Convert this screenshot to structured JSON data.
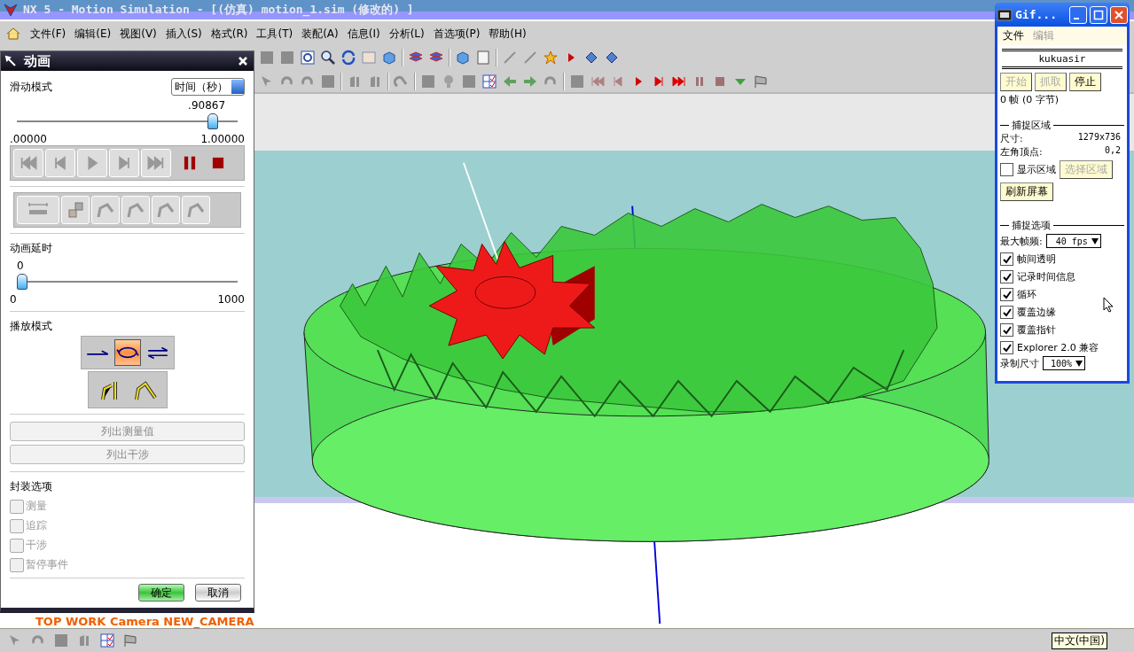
{
  "window": {
    "title": "NX 5 - Motion Simulation - [(仿真) motion_1.sim (修改的) ]"
  },
  "menu": [
    "文件(F)",
    "编辑(E)",
    "视图(V)",
    "插入(S)",
    "格式(R)",
    "工具(T)",
    "装配(A)",
    "信息(I)",
    "分析(L)",
    "首选项(P)",
    "帮助(H)"
  ],
  "animation_dialog": {
    "title": "动画",
    "slide_mode": {
      "label": "滑动模式",
      "value": "时间（秒）"
    },
    "time_slider": {
      "reading": ".90867",
      "level": 0.90867,
      "min": ".00000",
      "max": "1.00000"
    },
    "delay": {
      "label": "动画延时",
      "reading": "0",
      "level": 0,
      "min": "0",
      "max": "1000"
    },
    "playback": {
      "label": "播放模式",
      "modes": [
        {
          "kind": "once",
          "selected": false
        },
        {
          "kind": "loop",
          "selected": true
        },
        {
          "kind": "reverse",
          "selected": false
        }
      ]
    },
    "list_buttons": [
      {
        "label": "列出测量值",
        "disabled": true
      },
      {
        "label": "列出干涉",
        "disabled": true
      }
    ],
    "package_options": {
      "label": "封装选项",
      "items": [
        {
          "label": "测量",
          "checked": false,
          "disabled": true
        },
        {
          "label": "追踪",
          "checked": false,
          "disabled": true
        },
        {
          "label": "干涉",
          "checked": false,
          "disabled": true
        },
        {
          "label": "暂停事件",
          "checked": false,
          "disabled": true
        }
      ]
    },
    "ok": "确定",
    "cancel": "取消"
  },
  "viewport": {
    "camera_label": "TOP WORK Camera NEW_CAMERA"
  },
  "gif_window": {
    "title": "Gif...",
    "menu": [
      {
        "label": "文件",
        "disabled": false
      },
      {
        "label": "编辑",
        "disabled": true
      }
    ],
    "user": "kukuasir",
    "buttons": [
      {
        "label": "开始",
        "disabled": true
      },
      {
        "label": "抓取",
        "disabled": true
      },
      {
        "label": "停止",
        "disabled": false
      }
    ],
    "frames": "0 帧 (0 字节)",
    "capture_area": {
      "heading": "捕捉区域",
      "size_label": "尺寸:",
      "size": "1279x736",
      "corner_label": "左角顶点:",
      "corner": "0,2",
      "show_area": {
        "label": "显示区域",
        "checked": false
      },
      "select_button": {
        "label": "选择区域",
        "disabled": true
      },
      "refresh_button": "刷新屏幕"
    },
    "capture_options": {
      "heading": "捕捉选项",
      "fps_label": "最大帧频:",
      "fps": "40 fps",
      "options": [
        {
          "label": "帧间透明",
          "checked": true
        },
        {
          "label": "记录时间信息",
          "checked": true
        },
        {
          "label": "循环",
          "checked": true
        },
        {
          "label": "覆盖边缘",
          "checked": true
        },
        {
          "label": "覆盖指针",
          "checked": true
        },
        {
          "label": "Explorer 2.0 兼容",
          "checked": true
        }
      ],
      "size_label": "录制尺寸",
      "size": "100%"
    }
  },
  "status_bar": {
    "input_language": "中文(中国)"
  }
}
